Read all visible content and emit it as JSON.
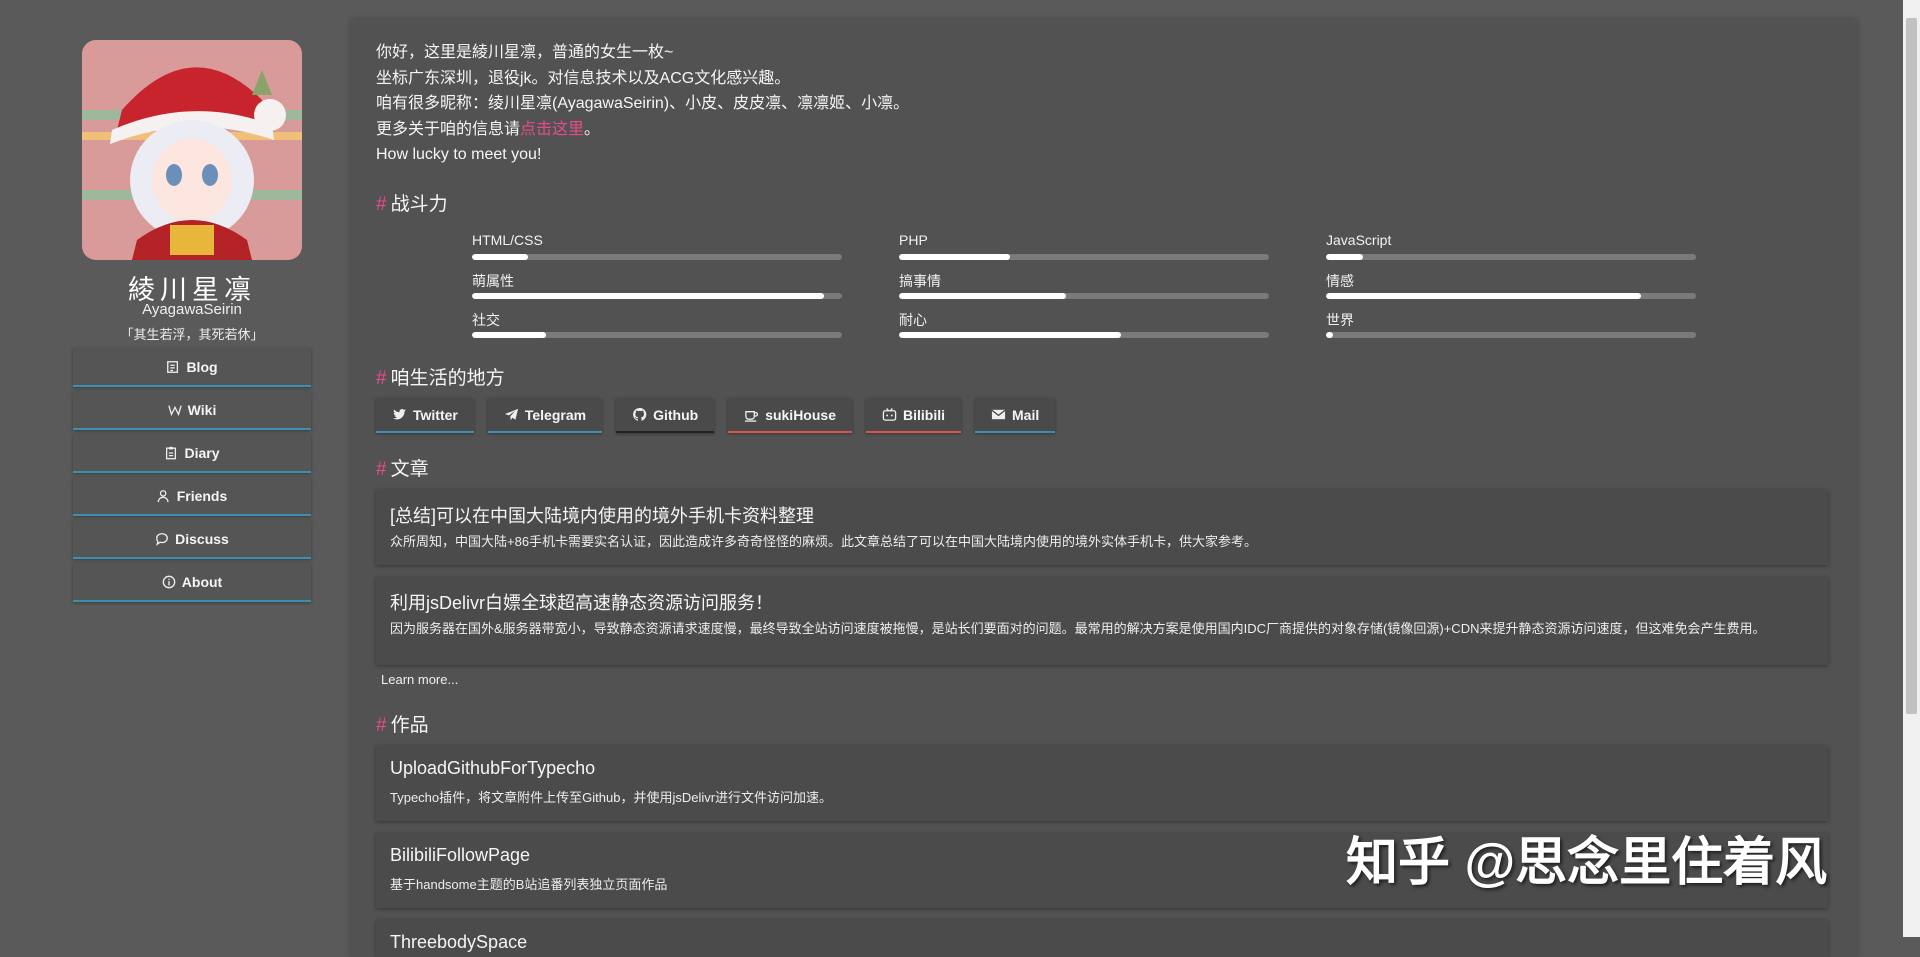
{
  "profile": {
    "name": "綾川星凛",
    "romaji": "AyagawaSeirin",
    "motto": "「其生若浮，其死若休」"
  },
  "nav": [
    {
      "label": "Blog",
      "icon": "note-icon"
    },
    {
      "label": "Wiki",
      "icon": "wiki-icon"
    },
    {
      "label": "Diary",
      "icon": "clipboard-icon"
    },
    {
      "label": "Friends",
      "icon": "user-icon"
    },
    {
      "label": "Discuss",
      "icon": "chat-icon"
    },
    {
      "label": "About",
      "icon": "info-icon"
    }
  ],
  "intro": {
    "line1": "你好，这里是綾川星凛，普通的女生一枚~",
    "line2": "坐标广东深圳，退役jk。对信息技术以及ACG文化感兴趣。",
    "line3": "咱有很多昵称：绫川星凛(AyagawaSeirin)、小皮、皮皮凛、凛凛姬、小凛。",
    "line4_prefix": "更多关于咱的信息请",
    "line4_link": "点击这里",
    "line4_suffix": "。",
    "line5": "How lucky to meet you!"
  },
  "sections": {
    "hash": "#",
    "skills": "战斗力",
    "places": "咱生活的地方",
    "articles": "文章",
    "works": "作品"
  },
  "skills": [
    {
      "label": "HTML/CSS",
      "level": 0.15
    },
    {
      "label": "PHP",
      "level": 0.3
    },
    {
      "label": "JavaScript",
      "level": 0.1
    },
    {
      "label": "萌属性",
      "level": 0.95
    },
    {
      "label": "搞事情",
      "level": 0.45
    },
    {
      "label": "情感",
      "level": 0.85
    },
    {
      "label": "社交",
      "level": 0.2
    },
    {
      "label": "耐心",
      "level": 0.6
    },
    {
      "label": "世界",
      "level": 0.02
    }
  ],
  "links": [
    {
      "label": "Twitter",
      "icon": "twitter-icon",
      "accent": "#3b8fb6"
    },
    {
      "label": "Telegram",
      "icon": "telegram-icon",
      "accent": "#3b8fb6"
    },
    {
      "label": "Github",
      "icon": "github-icon",
      "accent": "#222222"
    },
    {
      "label": "sukiHouse",
      "icon": "coffee-icon",
      "accent": "#d9534f"
    },
    {
      "label": "Bilibili",
      "icon": "tv-icon",
      "accent": "#d9534f"
    },
    {
      "label": "Mail",
      "icon": "mail-icon",
      "accent": "#3b8fb6"
    }
  ],
  "articles": [
    {
      "title": "[总结]可以在中国大陆境内使用的境外手机卡资料整理",
      "desc": "众所周知，中国大陆+86手机卡需要实名认证，因此造成许多奇奇怪怪的麻烦。此文章总结了可以在中国大陆境内使用的境外实体手机卡，供大家参考。"
    },
    {
      "title": "利用jsDelivr白嫖全球超高速静态资源访问服务！",
      "desc": "因为服务器在国外&服务器带宽小，导致静态资源请求速度慢，最终导致全站访问速度被拖慢，是站长们要面对的问题。最常用的解决方案是使用国内IDC厂商提供的对象存储(镜像回源)+CDN来提升静态资源访问速度，但这难免会产生费用。"
    }
  ],
  "learn_more": "Learn more...",
  "works": [
    {
      "title": "UploadGithubForTypecho",
      "desc": "Typecho插件，将文章附件上传至Github，并使用jsDelivr进行文件访问加速。"
    },
    {
      "title": "BilibiliFollowPage",
      "desc": "基于handsome主题的B站追番列表独立页面作品"
    },
    {
      "title": "ThreebodySpace",
      "desc": ""
    }
  ],
  "watermark": "知乎 @思念里住着风",
  "colors": {
    "accent_pink": "#e64c8a",
    "accent_blue": "#3b8fb6",
    "background": "#5a5a5a"
  }
}
